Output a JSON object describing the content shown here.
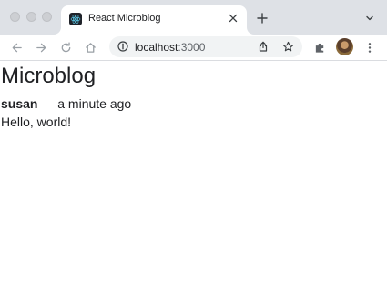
{
  "browser": {
    "tab": {
      "title": "React Microblog",
      "favicon": "react-icon",
      "close_icon": "close-icon"
    },
    "new_tab_icon": "plus-icon",
    "tab_search_icon": "chevron-down-icon",
    "nav": {
      "back_icon": "arrow-left-icon",
      "forward_icon": "arrow-right-icon",
      "reload_icon": "reload-icon",
      "home_icon": "home-icon"
    },
    "address_bar": {
      "info_icon": "info-icon",
      "host": "localhost",
      "port": ":3000",
      "share_icon": "share-icon",
      "bookmark_icon": "star-icon"
    },
    "extensions_icon": "puzzle-icon",
    "profile": "avatar",
    "menu_icon": "kebab-menu-icon"
  },
  "page": {
    "title": "Microblog",
    "posts": [
      {
        "author": "susan",
        "separator": " — ",
        "timestamp": "a minute ago",
        "text": "Hello, world!"
      }
    ]
  },
  "colors": {
    "tabstrip": "#dee1e6",
    "omnibox": "#f1f3f4",
    "text": "#202124",
    "icon": "#5f6368",
    "react_logo": "#61dafb"
  }
}
